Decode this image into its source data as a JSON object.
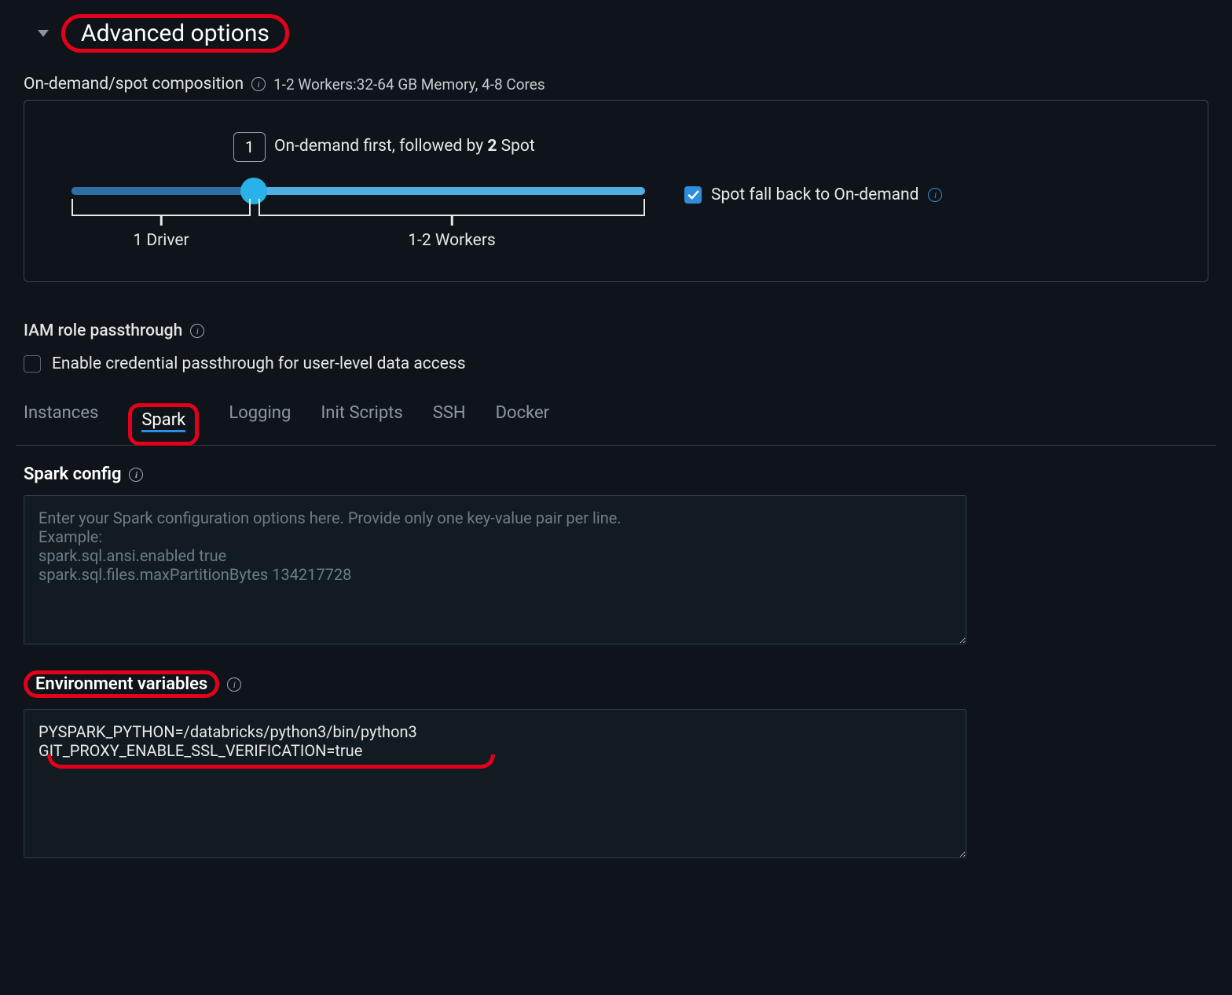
{
  "header": {
    "title": "Advanced options"
  },
  "composition": {
    "label": "On-demand/spot composition",
    "summary": "1-2 Workers:32-64 GB Memory, 4-8 Cores",
    "tooltip_value": "1",
    "inline_prefix": "On-demand first, followed by ",
    "inline_bold": "2",
    "inline_suffix": " Spot",
    "driver_label": "1 Driver",
    "workers_label": "1-2 Workers",
    "spot_checkbox_label": "Spot fall back to On-demand"
  },
  "iam": {
    "label": "IAM role passthrough",
    "checkbox_label": "Enable credential passthrough for user-level data access"
  },
  "tabs": {
    "instances": "Instances",
    "spark": "Spark",
    "logging": "Logging",
    "init_scripts": "Init Scripts",
    "ssh": "SSH",
    "docker": "Docker"
  },
  "spark_config": {
    "label": "Spark config",
    "placeholder": "Enter your Spark configuration options here. Provide only one key-value pair per line.\nExample:\nspark.sql.ansi.enabled true\nspark.sql.files.maxPartitionBytes 134217728"
  },
  "env_vars": {
    "label": "Environment variables",
    "value": "PYSPARK_PYTHON=/databricks/python3/bin/python3\nGIT_PROXY_ENABLE_SSL_VERIFICATION=true"
  }
}
